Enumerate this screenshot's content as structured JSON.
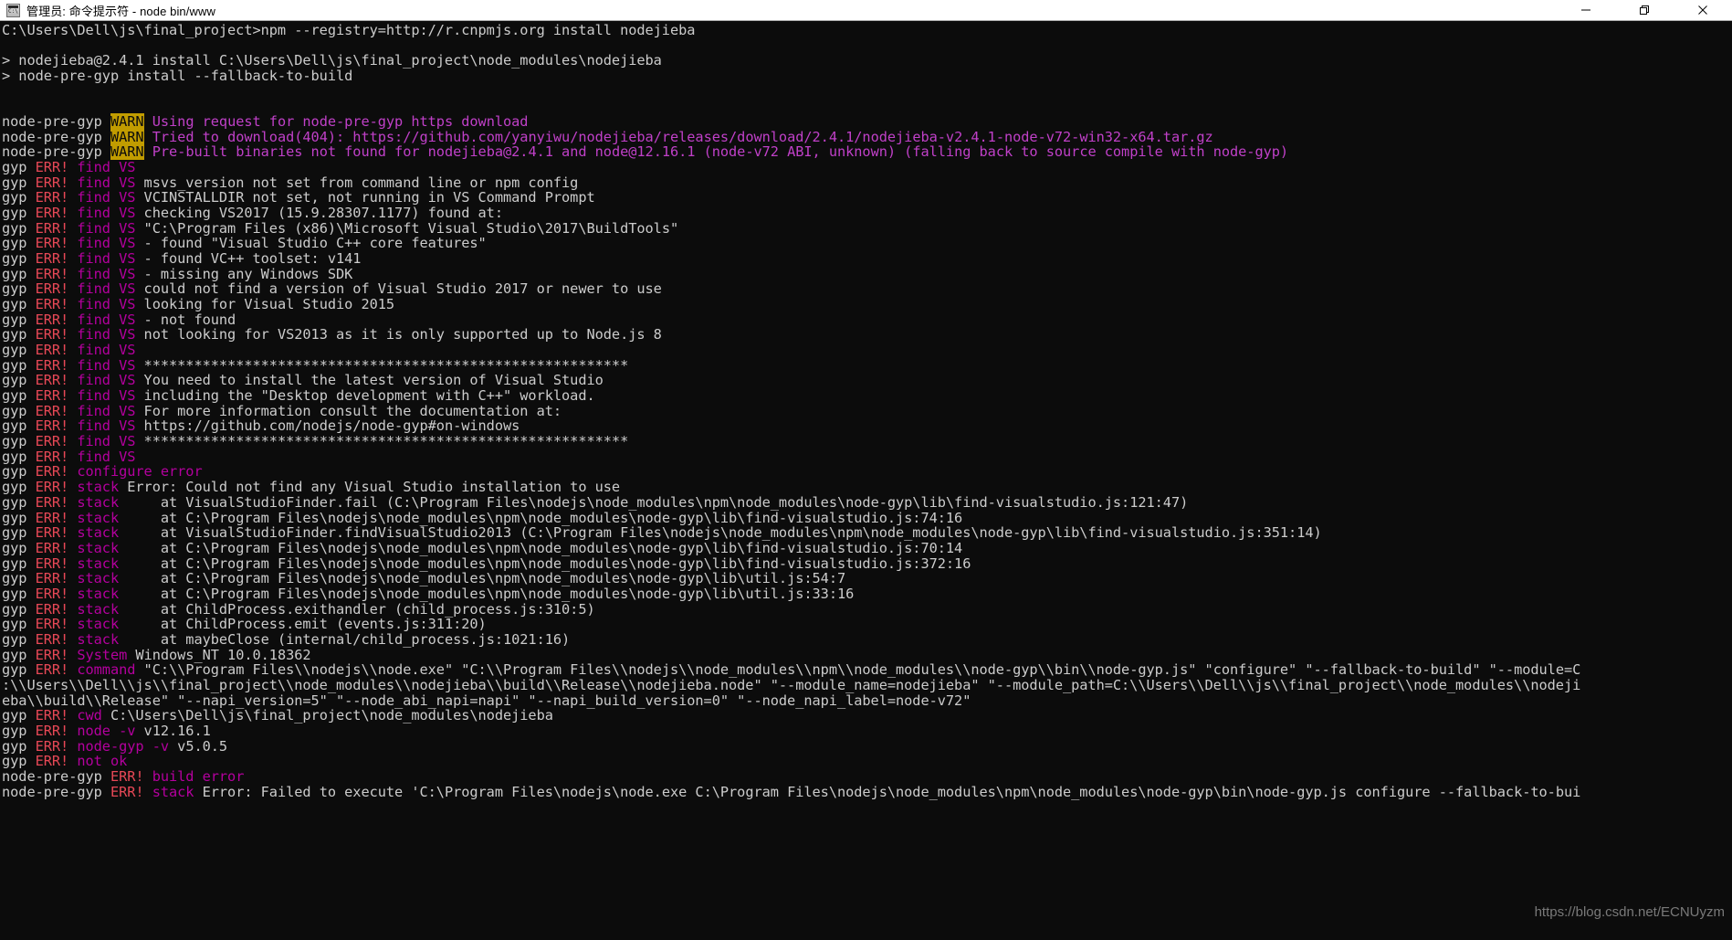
{
  "window": {
    "title": "管理员: 命令提示符 - node  bin/www",
    "icon": "console-icon",
    "controls": [
      {
        "name": "minimize-button",
        "label": "—"
      },
      {
        "name": "maximize-button",
        "label": "❐"
      },
      {
        "name": "close-button",
        "label": "✕"
      }
    ]
  },
  "colors": {
    "background": "#0c0c0c",
    "foreground": "#cccccc",
    "error_red": "#e74856",
    "magenta": "#b4009e",
    "warn_badge_bg": "#c19c00",
    "titlebar_bg": "#ffffff"
  },
  "watermark": "https://blog.csdn.net/ECNUyzm",
  "terminal": {
    "lines": [
      {
        "segments": [
          {
            "t": "C:\\Users\\Dell\\js\\final_project>npm --registry=http://r.cnpmjs.org install nodejieba",
            "c": "w"
          }
        ]
      },
      {
        "segments": [
          {
            "t": "",
            "c": "w"
          }
        ]
      },
      {
        "segments": [
          {
            "t": "> nodejieba@2.4.1 install C:\\Users\\Dell\\js\\final_project\\node_modules\\nodejieba",
            "c": "w"
          }
        ]
      },
      {
        "segments": [
          {
            "t": "> node-pre-gyp install --fallback-to-build",
            "c": "w"
          }
        ]
      },
      {
        "segments": [
          {
            "t": "",
            "c": "w"
          }
        ]
      },
      {
        "segments": [
          {
            "t": "",
            "c": "w"
          }
        ]
      },
      {
        "segments": [
          {
            "t": "node-pre-gyp ",
            "c": "w"
          },
          {
            "t": "WARN",
            "c": "warn"
          },
          {
            "t": " ",
            "c": "w"
          },
          {
            "t": "Using request for node-pre-gyp https download",
            "c": "mag2"
          }
        ]
      },
      {
        "segments": [
          {
            "t": "node-pre-gyp ",
            "c": "w"
          },
          {
            "t": "WARN",
            "c": "warn"
          },
          {
            "t": " ",
            "c": "w"
          },
          {
            "t": "Tried to download(404): https://github.com/yanyiwu/nodejieba/releases/download/2.4.1/nodejieba-v2.4.1-node-v72-win32-x64.tar.gz",
            "c": "mag2"
          }
        ]
      },
      {
        "segments": [
          {
            "t": "node-pre-gyp ",
            "c": "w"
          },
          {
            "t": "WARN",
            "c": "warn"
          },
          {
            "t": " ",
            "c": "w"
          },
          {
            "t": "Pre-built binaries not found for nodejieba@2.4.1 and node@12.16.1 (node-v72 ABI, unknown) (falling back to source compile with node-gyp)",
            "c": "mag2"
          }
        ]
      },
      {
        "segments": [
          {
            "t": "gyp ",
            "c": "w"
          },
          {
            "t": "ERR! ",
            "c": "red"
          },
          {
            "t": "find VS",
            "c": "mag"
          }
        ]
      },
      {
        "segments": [
          {
            "t": "gyp ",
            "c": "w"
          },
          {
            "t": "ERR! ",
            "c": "red"
          },
          {
            "t": "find VS",
            "c": "mag"
          },
          {
            "t": " msvs_version not set from command line or npm config",
            "c": "w"
          }
        ]
      },
      {
        "segments": [
          {
            "t": "gyp ",
            "c": "w"
          },
          {
            "t": "ERR! ",
            "c": "red"
          },
          {
            "t": "find VS",
            "c": "mag"
          },
          {
            "t": " VCINSTALLDIR not set, not running in VS Command Prompt",
            "c": "w"
          }
        ]
      },
      {
        "segments": [
          {
            "t": "gyp ",
            "c": "w"
          },
          {
            "t": "ERR! ",
            "c": "red"
          },
          {
            "t": "find VS",
            "c": "mag"
          },
          {
            "t": " checking VS2017 (15.9.28307.1177) found at:",
            "c": "w"
          }
        ]
      },
      {
        "segments": [
          {
            "t": "gyp ",
            "c": "w"
          },
          {
            "t": "ERR! ",
            "c": "red"
          },
          {
            "t": "find VS",
            "c": "mag"
          },
          {
            "t": " \"C:\\Program Files (x86)\\Microsoft Visual Studio\\2017\\BuildTools\"",
            "c": "w"
          }
        ]
      },
      {
        "segments": [
          {
            "t": "gyp ",
            "c": "w"
          },
          {
            "t": "ERR! ",
            "c": "red"
          },
          {
            "t": "find VS",
            "c": "mag"
          },
          {
            "t": " - found \"Visual Studio C++ core features\"",
            "c": "w"
          }
        ]
      },
      {
        "segments": [
          {
            "t": "gyp ",
            "c": "w"
          },
          {
            "t": "ERR! ",
            "c": "red"
          },
          {
            "t": "find VS",
            "c": "mag"
          },
          {
            "t": " - found VC++ toolset: v141",
            "c": "w"
          }
        ]
      },
      {
        "segments": [
          {
            "t": "gyp ",
            "c": "w"
          },
          {
            "t": "ERR! ",
            "c": "red"
          },
          {
            "t": "find VS",
            "c": "mag"
          },
          {
            "t": " - missing any Windows SDK",
            "c": "w"
          }
        ]
      },
      {
        "segments": [
          {
            "t": "gyp ",
            "c": "w"
          },
          {
            "t": "ERR! ",
            "c": "red"
          },
          {
            "t": "find VS",
            "c": "mag"
          },
          {
            "t": " could not find a version of Visual Studio 2017 or newer to use",
            "c": "w"
          }
        ]
      },
      {
        "segments": [
          {
            "t": "gyp ",
            "c": "w"
          },
          {
            "t": "ERR! ",
            "c": "red"
          },
          {
            "t": "find VS",
            "c": "mag"
          },
          {
            "t": " looking for Visual Studio 2015",
            "c": "w"
          }
        ]
      },
      {
        "segments": [
          {
            "t": "gyp ",
            "c": "w"
          },
          {
            "t": "ERR! ",
            "c": "red"
          },
          {
            "t": "find VS",
            "c": "mag"
          },
          {
            "t": " - not found",
            "c": "w"
          }
        ]
      },
      {
        "segments": [
          {
            "t": "gyp ",
            "c": "w"
          },
          {
            "t": "ERR! ",
            "c": "red"
          },
          {
            "t": "find VS",
            "c": "mag"
          },
          {
            "t": " not looking for VS2013 as it is only supported up to Node.js 8",
            "c": "w"
          }
        ]
      },
      {
        "segments": [
          {
            "t": "gyp ",
            "c": "w"
          },
          {
            "t": "ERR! ",
            "c": "red"
          },
          {
            "t": "find VS",
            "c": "mag"
          }
        ]
      },
      {
        "segments": [
          {
            "t": "gyp ",
            "c": "w"
          },
          {
            "t": "ERR! ",
            "c": "red"
          },
          {
            "t": "find VS",
            "c": "mag"
          },
          {
            "t": " **********************************************************",
            "c": "w"
          }
        ]
      },
      {
        "segments": [
          {
            "t": "gyp ",
            "c": "w"
          },
          {
            "t": "ERR! ",
            "c": "red"
          },
          {
            "t": "find VS",
            "c": "mag"
          },
          {
            "t": " You need to install the latest version of Visual Studio",
            "c": "w"
          }
        ]
      },
      {
        "segments": [
          {
            "t": "gyp ",
            "c": "w"
          },
          {
            "t": "ERR! ",
            "c": "red"
          },
          {
            "t": "find VS",
            "c": "mag"
          },
          {
            "t": " including the \"Desktop development with C++\" workload.",
            "c": "w"
          }
        ]
      },
      {
        "segments": [
          {
            "t": "gyp ",
            "c": "w"
          },
          {
            "t": "ERR! ",
            "c": "red"
          },
          {
            "t": "find VS",
            "c": "mag"
          },
          {
            "t": " For more information consult the documentation at:",
            "c": "w"
          }
        ]
      },
      {
        "segments": [
          {
            "t": "gyp ",
            "c": "w"
          },
          {
            "t": "ERR! ",
            "c": "red"
          },
          {
            "t": "find VS",
            "c": "mag"
          },
          {
            "t": " https://github.com/nodejs/node-gyp#on-windows",
            "c": "w"
          }
        ]
      },
      {
        "segments": [
          {
            "t": "gyp ",
            "c": "w"
          },
          {
            "t": "ERR! ",
            "c": "red"
          },
          {
            "t": "find VS",
            "c": "mag"
          },
          {
            "t": " **********************************************************",
            "c": "w"
          }
        ]
      },
      {
        "segments": [
          {
            "t": "gyp ",
            "c": "w"
          },
          {
            "t": "ERR! ",
            "c": "red"
          },
          {
            "t": "find VS",
            "c": "mag"
          }
        ]
      },
      {
        "segments": [
          {
            "t": "gyp ",
            "c": "w"
          },
          {
            "t": "ERR! ",
            "c": "red"
          },
          {
            "t": "configure error",
            "c": "mag"
          }
        ]
      },
      {
        "segments": [
          {
            "t": "gyp ",
            "c": "w"
          },
          {
            "t": "ERR! ",
            "c": "red"
          },
          {
            "t": "stack",
            "c": "mag"
          },
          {
            "t": " Error: Could not find any Visual Studio installation to use",
            "c": "w"
          }
        ]
      },
      {
        "segments": [
          {
            "t": "gyp ",
            "c": "w"
          },
          {
            "t": "ERR! ",
            "c": "red"
          },
          {
            "t": "stack",
            "c": "mag"
          },
          {
            "t": "     at VisualStudioFinder.fail (C:\\Program Files\\nodejs\\node_modules\\npm\\node_modules\\node-gyp\\lib\\find-visualstudio.js:121:47)",
            "c": "w"
          }
        ]
      },
      {
        "segments": [
          {
            "t": "gyp ",
            "c": "w"
          },
          {
            "t": "ERR! ",
            "c": "red"
          },
          {
            "t": "stack",
            "c": "mag"
          },
          {
            "t": "     at C:\\Program Files\\nodejs\\node_modules\\npm\\node_modules\\node-gyp\\lib\\find-visualstudio.js:74:16",
            "c": "w"
          }
        ]
      },
      {
        "segments": [
          {
            "t": "gyp ",
            "c": "w"
          },
          {
            "t": "ERR! ",
            "c": "red"
          },
          {
            "t": "stack",
            "c": "mag"
          },
          {
            "t": "     at VisualStudioFinder.findVisualStudio2013 (C:\\Program Files\\nodejs\\node_modules\\npm\\node_modules\\node-gyp\\lib\\find-visualstudio.js:351:14)",
            "c": "w"
          }
        ]
      },
      {
        "segments": [
          {
            "t": "gyp ",
            "c": "w"
          },
          {
            "t": "ERR! ",
            "c": "red"
          },
          {
            "t": "stack",
            "c": "mag"
          },
          {
            "t": "     at C:\\Program Files\\nodejs\\node_modules\\npm\\node_modules\\node-gyp\\lib\\find-visualstudio.js:70:14",
            "c": "w"
          }
        ]
      },
      {
        "segments": [
          {
            "t": "gyp ",
            "c": "w"
          },
          {
            "t": "ERR! ",
            "c": "red"
          },
          {
            "t": "stack",
            "c": "mag"
          },
          {
            "t": "     at C:\\Program Files\\nodejs\\node_modules\\npm\\node_modules\\node-gyp\\lib\\find-visualstudio.js:372:16",
            "c": "w"
          }
        ]
      },
      {
        "segments": [
          {
            "t": "gyp ",
            "c": "w"
          },
          {
            "t": "ERR! ",
            "c": "red"
          },
          {
            "t": "stack",
            "c": "mag"
          },
          {
            "t": "     at C:\\Program Files\\nodejs\\node_modules\\npm\\node_modules\\node-gyp\\lib\\util.js:54:7",
            "c": "w"
          }
        ]
      },
      {
        "segments": [
          {
            "t": "gyp ",
            "c": "w"
          },
          {
            "t": "ERR! ",
            "c": "red"
          },
          {
            "t": "stack",
            "c": "mag"
          },
          {
            "t": "     at C:\\Program Files\\nodejs\\node_modules\\npm\\node_modules\\node-gyp\\lib\\util.js:33:16",
            "c": "w"
          }
        ]
      },
      {
        "segments": [
          {
            "t": "gyp ",
            "c": "w"
          },
          {
            "t": "ERR! ",
            "c": "red"
          },
          {
            "t": "stack",
            "c": "mag"
          },
          {
            "t": "     at ChildProcess.exithandler (child_process.js:310:5)",
            "c": "w"
          }
        ]
      },
      {
        "segments": [
          {
            "t": "gyp ",
            "c": "w"
          },
          {
            "t": "ERR! ",
            "c": "red"
          },
          {
            "t": "stack",
            "c": "mag"
          },
          {
            "t": "     at ChildProcess.emit (events.js:311:20)",
            "c": "w"
          }
        ]
      },
      {
        "segments": [
          {
            "t": "gyp ",
            "c": "w"
          },
          {
            "t": "ERR! ",
            "c": "red"
          },
          {
            "t": "stack",
            "c": "mag"
          },
          {
            "t": "     at maybeClose (internal/child_process.js:1021:16)",
            "c": "w"
          }
        ]
      },
      {
        "segments": [
          {
            "t": "gyp ",
            "c": "w"
          },
          {
            "t": "ERR! ",
            "c": "red"
          },
          {
            "t": "System",
            "c": "mag"
          },
          {
            "t": " Windows_NT 10.0.18362",
            "c": "w"
          }
        ]
      },
      {
        "segments": [
          {
            "t": "gyp ",
            "c": "w"
          },
          {
            "t": "ERR! ",
            "c": "red"
          },
          {
            "t": "command",
            "c": "mag"
          },
          {
            "t": " \"C:\\\\Program Files\\\\nodejs\\\\node.exe\" \"C:\\\\Program Files\\\\nodejs\\\\node_modules\\\\npm\\\\node_modules\\\\node-gyp\\\\bin\\\\node-gyp.js\" \"configure\" \"--fallback-to-build\" \"--module=C",
            "c": "w"
          }
        ]
      },
      {
        "segments": [
          {
            "t": ":\\\\Users\\\\Dell\\\\js\\\\final_project\\\\node_modules\\\\nodejieba\\\\build\\\\Release\\\\nodejieba.node\" \"--module_name=nodejieba\" \"--module_path=C:\\\\Users\\\\Dell\\\\js\\\\final_project\\\\node_modules\\\\nodeji",
            "c": "w"
          }
        ]
      },
      {
        "segments": [
          {
            "t": "eba\\\\build\\\\Release\" \"--napi_version=5\" \"--node_abi_napi=napi\" \"--napi_build_version=0\" \"--node_napi_label=node-v72\"",
            "c": "w"
          }
        ]
      },
      {
        "segments": [
          {
            "t": "gyp ",
            "c": "w"
          },
          {
            "t": "ERR! ",
            "c": "red"
          },
          {
            "t": "cwd",
            "c": "mag"
          },
          {
            "t": " C:\\Users\\Dell\\js\\final_project\\node_modules\\nodejieba",
            "c": "w"
          }
        ]
      },
      {
        "segments": [
          {
            "t": "gyp ",
            "c": "w"
          },
          {
            "t": "ERR! ",
            "c": "red"
          },
          {
            "t": "node -v",
            "c": "mag"
          },
          {
            "t": " v12.16.1",
            "c": "w"
          }
        ]
      },
      {
        "segments": [
          {
            "t": "gyp ",
            "c": "w"
          },
          {
            "t": "ERR! ",
            "c": "red"
          },
          {
            "t": "node-gyp -v",
            "c": "mag"
          },
          {
            "t": " v5.0.5",
            "c": "w"
          }
        ]
      },
      {
        "segments": [
          {
            "t": "gyp ",
            "c": "w"
          },
          {
            "t": "ERR! ",
            "c": "red"
          },
          {
            "t": "not ok",
            "c": "mag"
          }
        ]
      },
      {
        "segments": [
          {
            "t": "node-pre-gyp ",
            "c": "w"
          },
          {
            "t": "ERR! ",
            "c": "red"
          },
          {
            "t": "build error",
            "c": "mag"
          }
        ]
      },
      {
        "segments": [
          {
            "t": "node-pre-gyp ",
            "c": "w"
          },
          {
            "t": "ERR! ",
            "c": "red"
          },
          {
            "t": "stack",
            "c": "mag"
          },
          {
            "t": " Error: Failed to execute 'C:\\Program Files\\nodejs\\node.exe C:\\Program Files\\nodejs\\node_modules\\npm\\node_modules\\node-gyp\\bin\\node-gyp.js configure --fallback-to-bui",
            "c": "w"
          }
        ]
      }
    ]
  }
}
